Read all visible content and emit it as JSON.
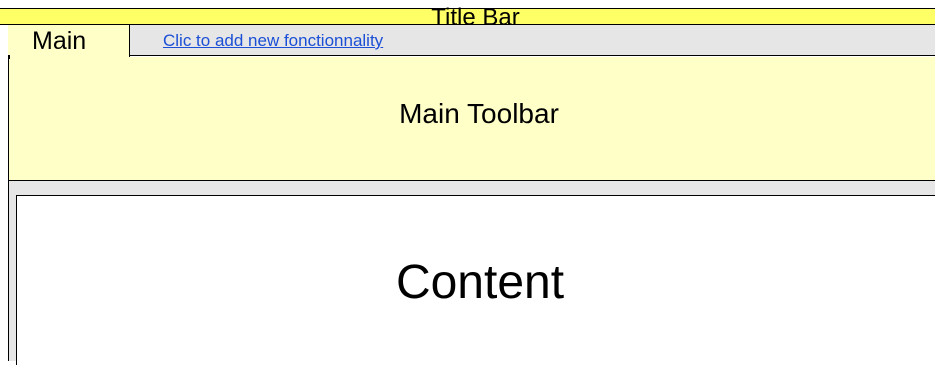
{
  "title_bar": {
    "title": "Title Bar"
  },
  "tabs": {
    "main_label": "Main",
    "add_link": "Clic to add new fonctionnality"
  },
  "toolbar": {
    "label": "Main Toolbar"
  },
  "content": {
    "label": "Content"
  },
  "colors": {
    "title_bar": "#ffff66",
    "toolbar": "#ffffc8",
    "tab_bar": "#e6e6e6",
    "link": "#1a4fd6"
  }
}
